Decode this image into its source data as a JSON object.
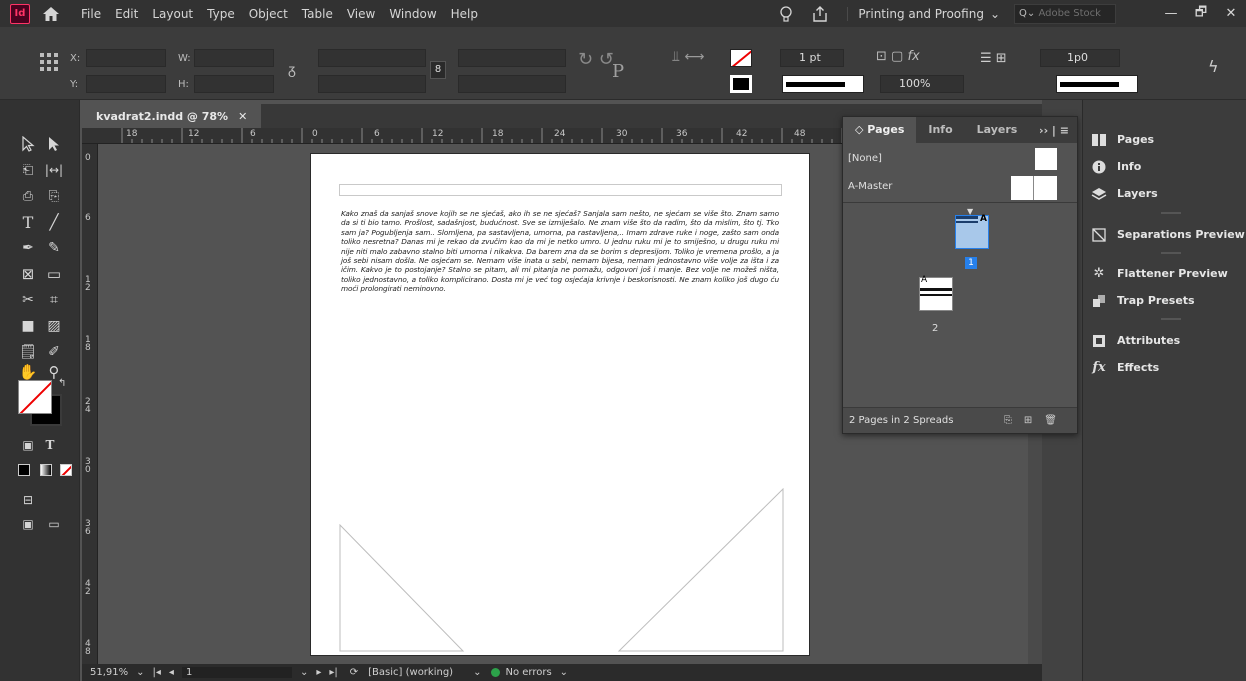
{
  "app": {
    "logo": "Id",
    "menu": [
      "File",
      "Edit",
      "Layout",
      "Type",
      "Object",
      "Table",
      "View",
      "Window",
      "Help"
    ],
    "workspace": "Printing and Proofing",
    "stock_search_placeholder": "Adobe Stock",
    "window_controls": [
      "—",
      "🗗",
      "✕"
    ]
  },
  "control_panel": {
    "x_label": "X:",
    "y_label": "Y:",
    "w_label": "W:",
    "h_label": "H:",
    "stroke_weight": "1 pt",
    "opacity": "100%",
    "offset": "1p0"
  },
  "document": {
    "tab_title": "kvadrat2.indd @ 78%",
    "tab_close": "✕",
    "h_ruler_ticks": [
      "18",
      "12",
      "6",
      "0",
      "6",
      "12",
      "18",
      "24",
      "30",
      "36",
      "42",
      "48"
    ],
    "v_ruler_ticks": [
      "0",
      "6",
      "1\n2",
      "1\n8",
      "2\n4",
      "3\n0",
      "3\n6",
      "4\n2",
      "4\n8"
    ],
    "body_text": "Kako znaš da sanjaš snove kojih se ne sjećaš, ako ih se ne sjećaš? Sanjala sam nešto, ne sjećam se više što. Znam samo da si ti bio tamo. Prošlost, sadašnjost, budućnost. Sve se izmiješalo. Ne znam više što da radim, što da mislim, što tj. Tko sam ja? Pogubljenja sam.. Slomljena, pa sastavljena, umorna, pa rastavljena,.. Imam zdrave ruke i noge, zašto sam onda toliko nesretna? Danas mi je rekao da zvučim kao da mi je netko umro. U jednu ruku mi je to smiješno, u drugu ruku mi nije niti malo zabavno stalno biti umorna i nikakva. Da barem zna da se borim s depresijom. Toliko je vremena prošlo, a ja još sebi nisam došla. Ne osjećam se. Nemam više inata u sebi, nemam bijesa, nemam jednostavno više volje za išta i za ičim. Kakvo je to postojanje? Stalno se pitam, ali mi pitanja ne pomažu, odgovori još i manje. Bez volje ne možeš ništa, toliko jednostavno, a toliko komplicirano. Dosta mi je već tog osjećaja krivnje i beskorisnosti. Ne znam koliko još dugo ću moći prolongirati neminovno."
  },
  "status_bar": {
    "zoom": "51,91%",
    "page": "1",
    "preflight_profile": "[Basic] (working)",
    "errors": "No errors"
  },
  "pages_panel": {
    "tabs": [
      "Pages",
      "Info",
      "Layers"
    ],
    "none_label": "[None]",
    "master_label": "A-Master",
    "page_numbers": [
      "1",
      "2"
    ],
    "master_prefix": "A",
    "footer": "2 Pages in 2 Spreads"
  },
  "dock": {
    "items": [
      "Pages",
      "Info",
      "Layers",
      "Separations Preview",
      "Flattener Preview",
      "Trap Presets",
      "Attributes",
      "Effects"
    ]
  },
  "colors": {
    "accent": "#2680eb",
    "app_brand": "#ff3366",
    "status_ok": "#2ca24a"
  }
}
